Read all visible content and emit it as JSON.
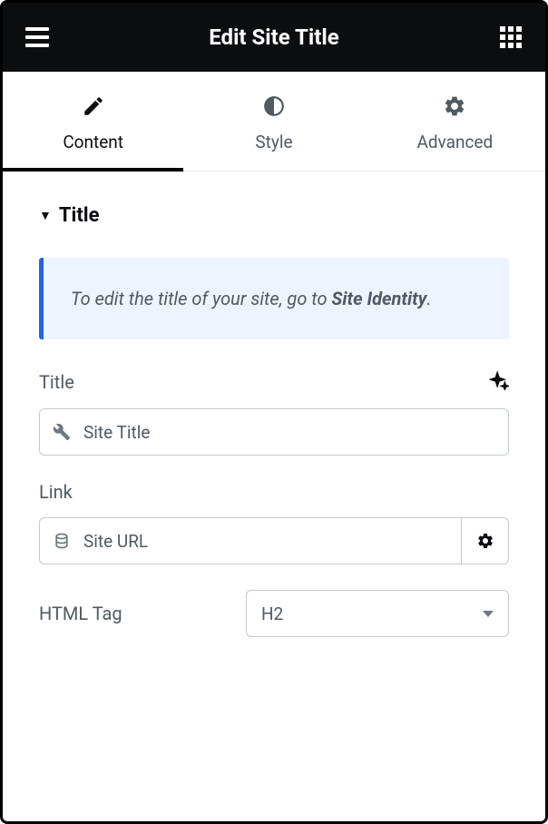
{
  "header": {
    "title": "Edit Site Title"
  },
  "tabs": [
    {
      "label": "Content",
      "active": true
    },
    {
      "label": "Style",
      "active": false
    },
    {
      "label": "Advanced",
      "active": false
    }
  ],
  "section": {
    "title": "Title"
  },
  "info": {
    "prefix": "To edit the title of your site, go to ",
    "bold": "Site Identity",
    "suffix": "."
  },
  "fields": {
    "title": {
      "label": "Title",
      "value": "Site Title"
    },
    "link": {
      "label": "Link",
      "value": "Site URL"
    },
    "htmlTag": {
      "label": "HTML Tag",
      "value": "H2"
    }
  }
}
